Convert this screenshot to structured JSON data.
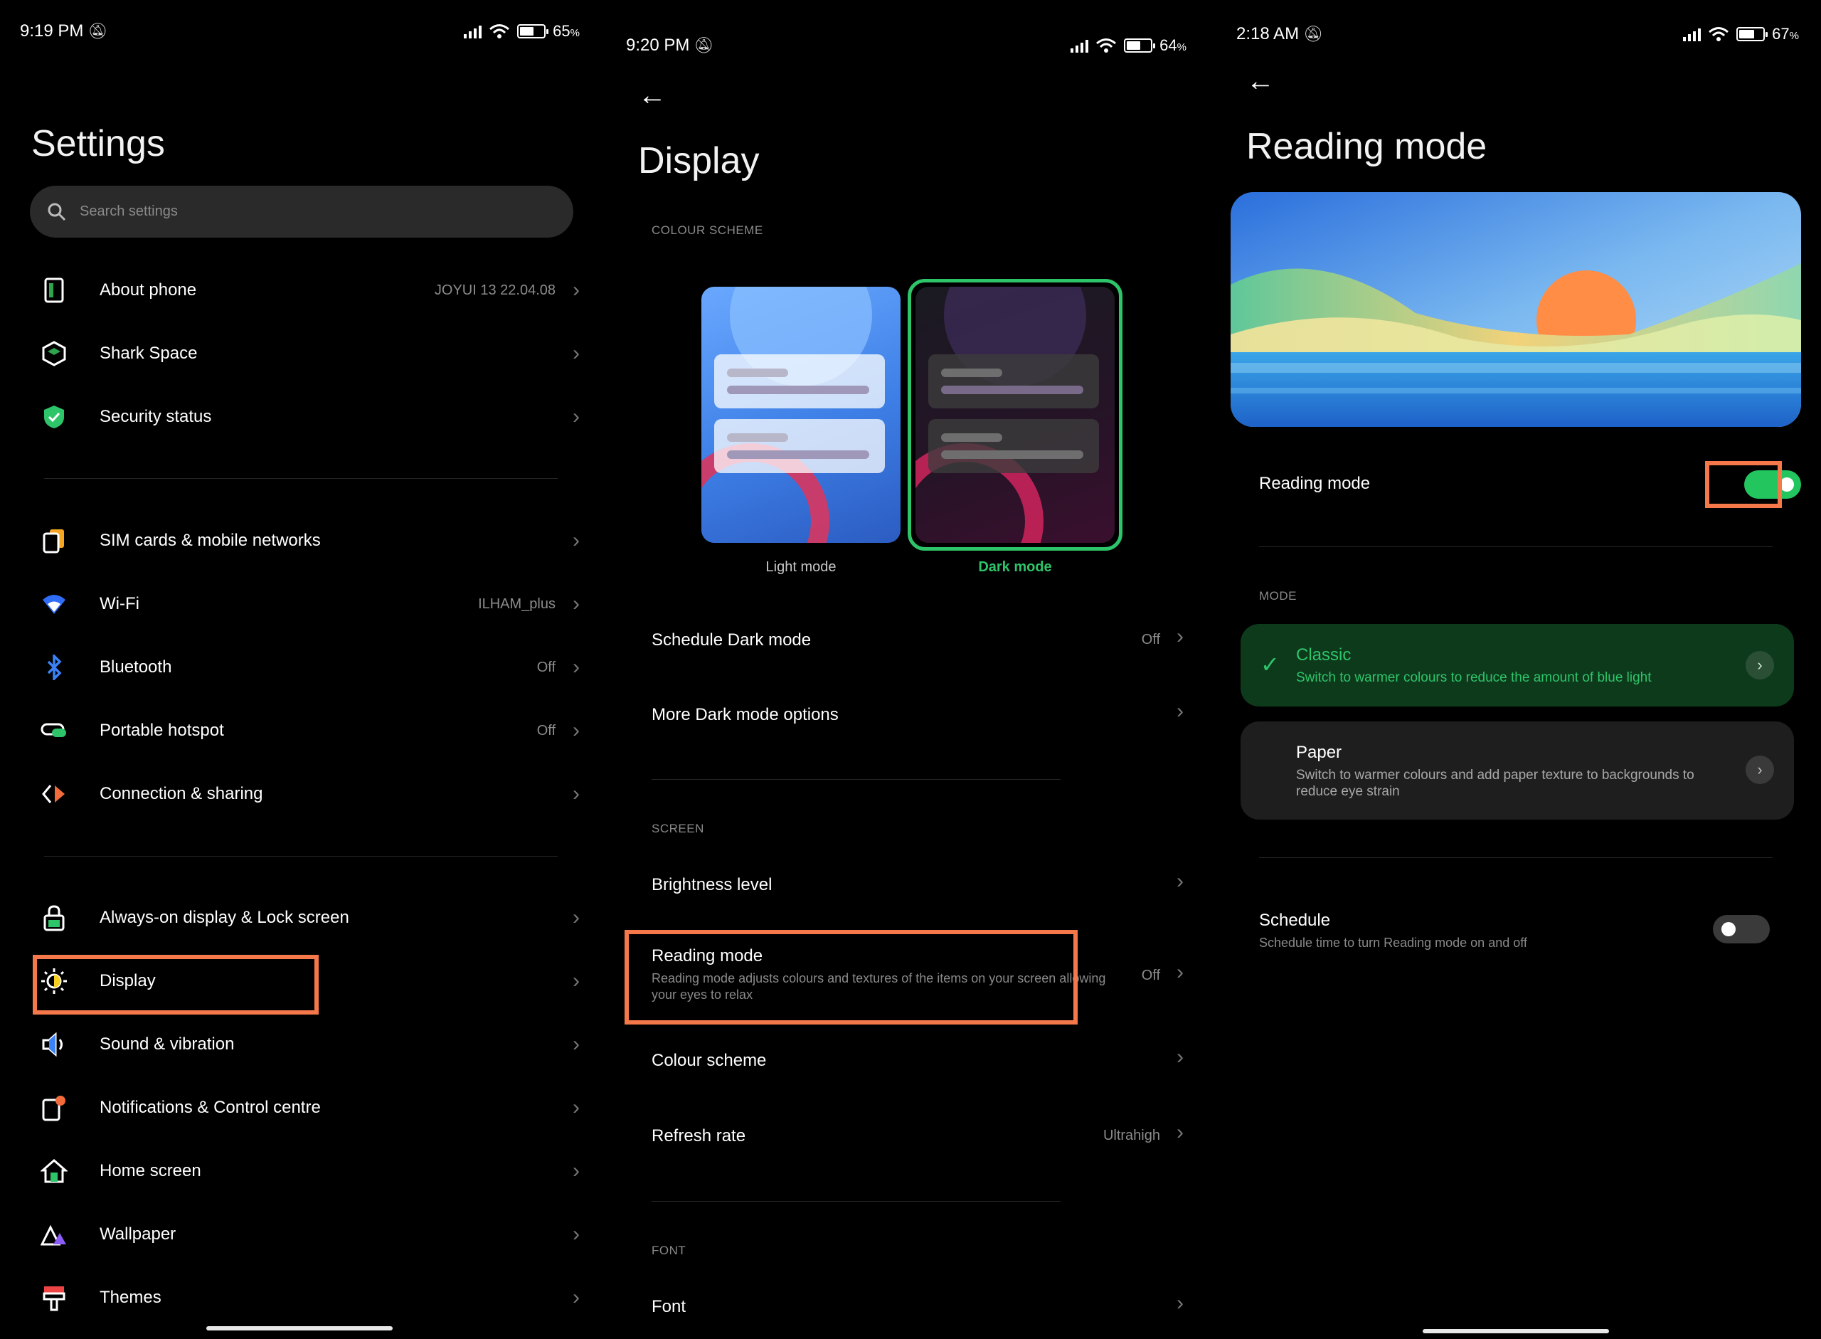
{
  "panel1": {
    "status": {
      "time": "9:19 PM",
      "battery": "65",
      "battery_suffix": "%"
    },
    "title": "Settings",
    "search_placeholder": "Search settings",
    "groups": [
      [
        {
          "label": "About phone",
          "value": "JOYUI 13 22.04.08",
          "icon": "phone-icon"
        },
        {
          "label": "Shark Space",
          "value": "",
          "icon": "shark-space-icon"
        },
        {
          "label": "Security status",
          "value": "",
          "icon": "shield-check-icon"
        }
      ],
      [
        {
          "label": "SIM cards & mobile networks",
          "value": "",
          "icon": "sim-card-icon"
        },
        {
          "label": "Wi-Fi",
          "value": "ILHAM_plus",
          "icon": "wifi-icon"
        },
        {
          "label": "Bluetooth",
          "value": "Off",
          "icon": "bluetooth-icon"
        },
        {
          "label": "Portable hotspot",
          "value": "Off",
          "icon": "hotspot-icon"
        },
        {
          "label": "Connection & sharing",
          "value": "",
          "icon": "connection-icon"
        }
      ],
      [
        {
          "label": "Always-on display & Lock screen",
          "value": "",
          "icon": "lock-icon"
        },
        {
          "label": "Display",
          "value": "",
          "icon": "brightness-icon"
        },
        {
          "label": "Sound & vibration",
          "value": "",
          "icon": "speaker-icon"
        },
        {
          "label": "Notifications & Control centre",
          "value": "",
          "icon": "notification-icon"
        },
        {
          "label": "Home screen",
          "value": "",
          "icon": "home-icon"
        },
        {
          "label": "Wallpaper",
          "value": "",
          "icon": "wallpaper-icon"
        },
        {
          "label": "Themes",
          "value": "",
          "icon": "themes-icon"
        }
      ]
    ]
  },
  "panel2": {
    "status": {
      "time": "9:20 PM",
      "battery": "64",
      "battery_suffix": "%"
    },
    "title": "Display",
    "colour_scheme_header": "COLOUR SCHEME",
    "light_mode_label": "Light mode",
    "dark_mode_label": "Dark mode",
    "rows_top": [
      {
        "label": "Schedule Dark mode",
        "value": "Off"
      },
      {
        "label": "More Dark mode options",
        "value": ""
      }
    ],
    "screen_header": "SCREEN",
    "brightness_label": "Brightness level",
    "reading_mode": {
      "label": "Reading mode",
      "description": "Reading mode adjusts colours and textures of the items on your screen allowing your eyes to relax",
      "value": "Off"
    },
    "colour_scheme_label": "Colour scheme",
    "refresh_rate": {
      "label": "Refresh rate",
      "value": "Ultrahigh"
    },
    "font_header": "FONT",
    "font_label": "Font"
  },
  "panel3": {
    "status": {
      "time": "2:18 AM",
      "battery": "67",
      "battery_suffix": "%"
    },
    "title": "Reading mode",
    "reading_mode_label": "Reading mode",
    "reading_mode_on": true,
    "mode_header": "MODE",
    "modes": [
      {
        "title": "Classic",
        "description": "Switch to warmer colours to reduce the amount of blue light",
        "selected": true
      },
      {
        "title": "Paper",
        "description": "Switch to warmer colours and add paper texture to backgrounds to reduce eye strain",
        "selected": false
      }
    ],
    "schedule": {
      "label": "Schedule",
      "description": "Schedule time to turn Reading mode on and off",
      "on": false
    }
  },
  "colors": {
    "highlight": "#f5784a",
    "accent_green": "#22c55e",
    "card_dark": "#1f1f1f",
    "classic_bg": "#0f3d1f"
  }
}
